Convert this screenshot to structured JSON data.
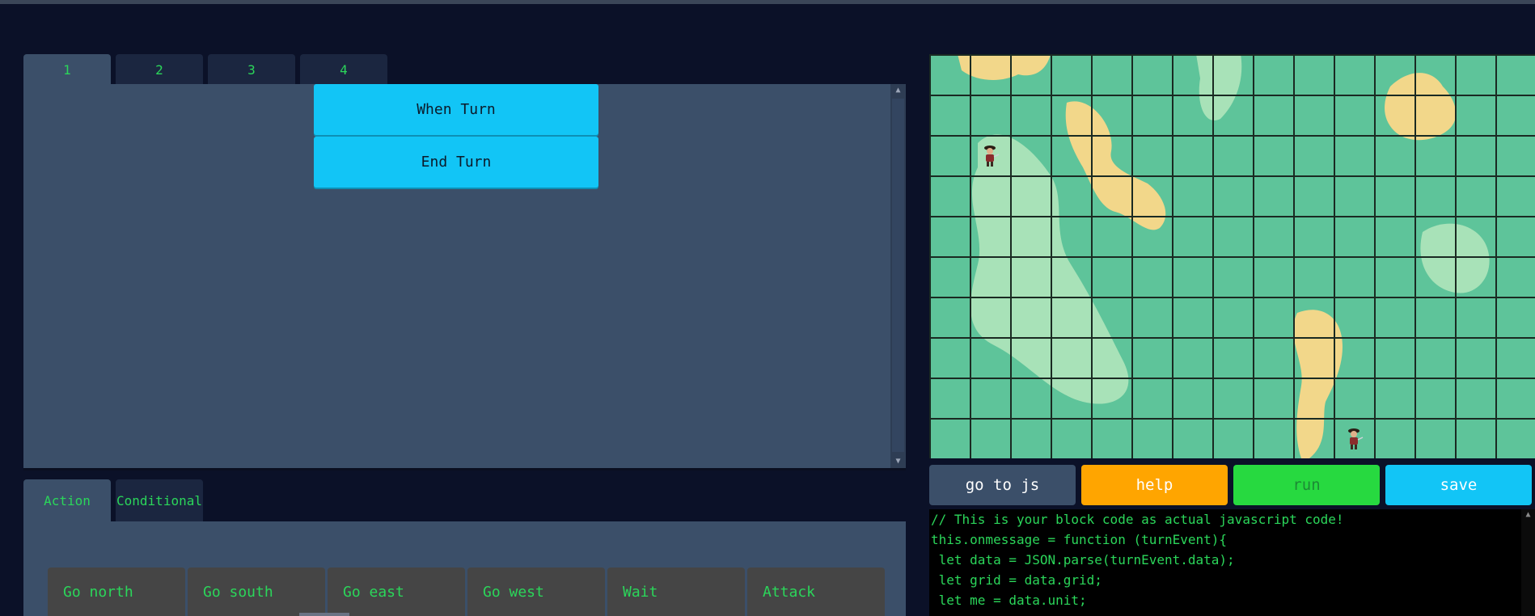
{
  "workspace_tabs": [
    "1",
    "2",
    "3",
    "4"
  ],
  "active_workspace_tab": "1",
  "workspace_blocks": [
    "When Turn",
    "End Turn"
  ],
  "palette_tabs": [
    "Action",
    "Conditional"
  ],
  "active_palette_tab": "Action",
  "palette_blocks": [
    "Go north",
    "Go south",
    "Go east",
    "Go west",
    "Wait",
    "Attack"
  ],
  "buttons": {
    "go_to_js": "go to js",
    "help": "help",
    "run": "run",
    "save": "save"
  },
  "button_colors": {
    "go_to_js": "#3b4f69",
    "help": "#ffa500",
    "run": "#27d940",
    "save": "#12c5f6"
  },
  "code_lines": [
    "// This is your block code as actual javascript code!",
    "this.onmessage = function (turnEvent){",
    " let data = JSON.parse(turnEvent.data);",
    " let grid = data.grid;",
    " let me = data.unit;"
  ],
  "map": {
    "columns": 15,
    "rows": 10,
    "terrain_colors": {
      "grass": "#5ec49a",
      "light_grass": "#a8e2b8",
      "sand": "#f2d78a",
      "grid_line": "#1a2a22"
    },
    "units": [
      {
        "col": 1,
        "row": 2,
        "icon": "pirate-icon"
      },
      {
        "col": 10,
        "row": 9,
        "icon": "pirate-icon"
      }
    ]
  },
  "accent_colors": {
    "text_green": "#2bd65a",
    "panel": "#3b4f69",
    "background": "#0b1128"
  }
}
